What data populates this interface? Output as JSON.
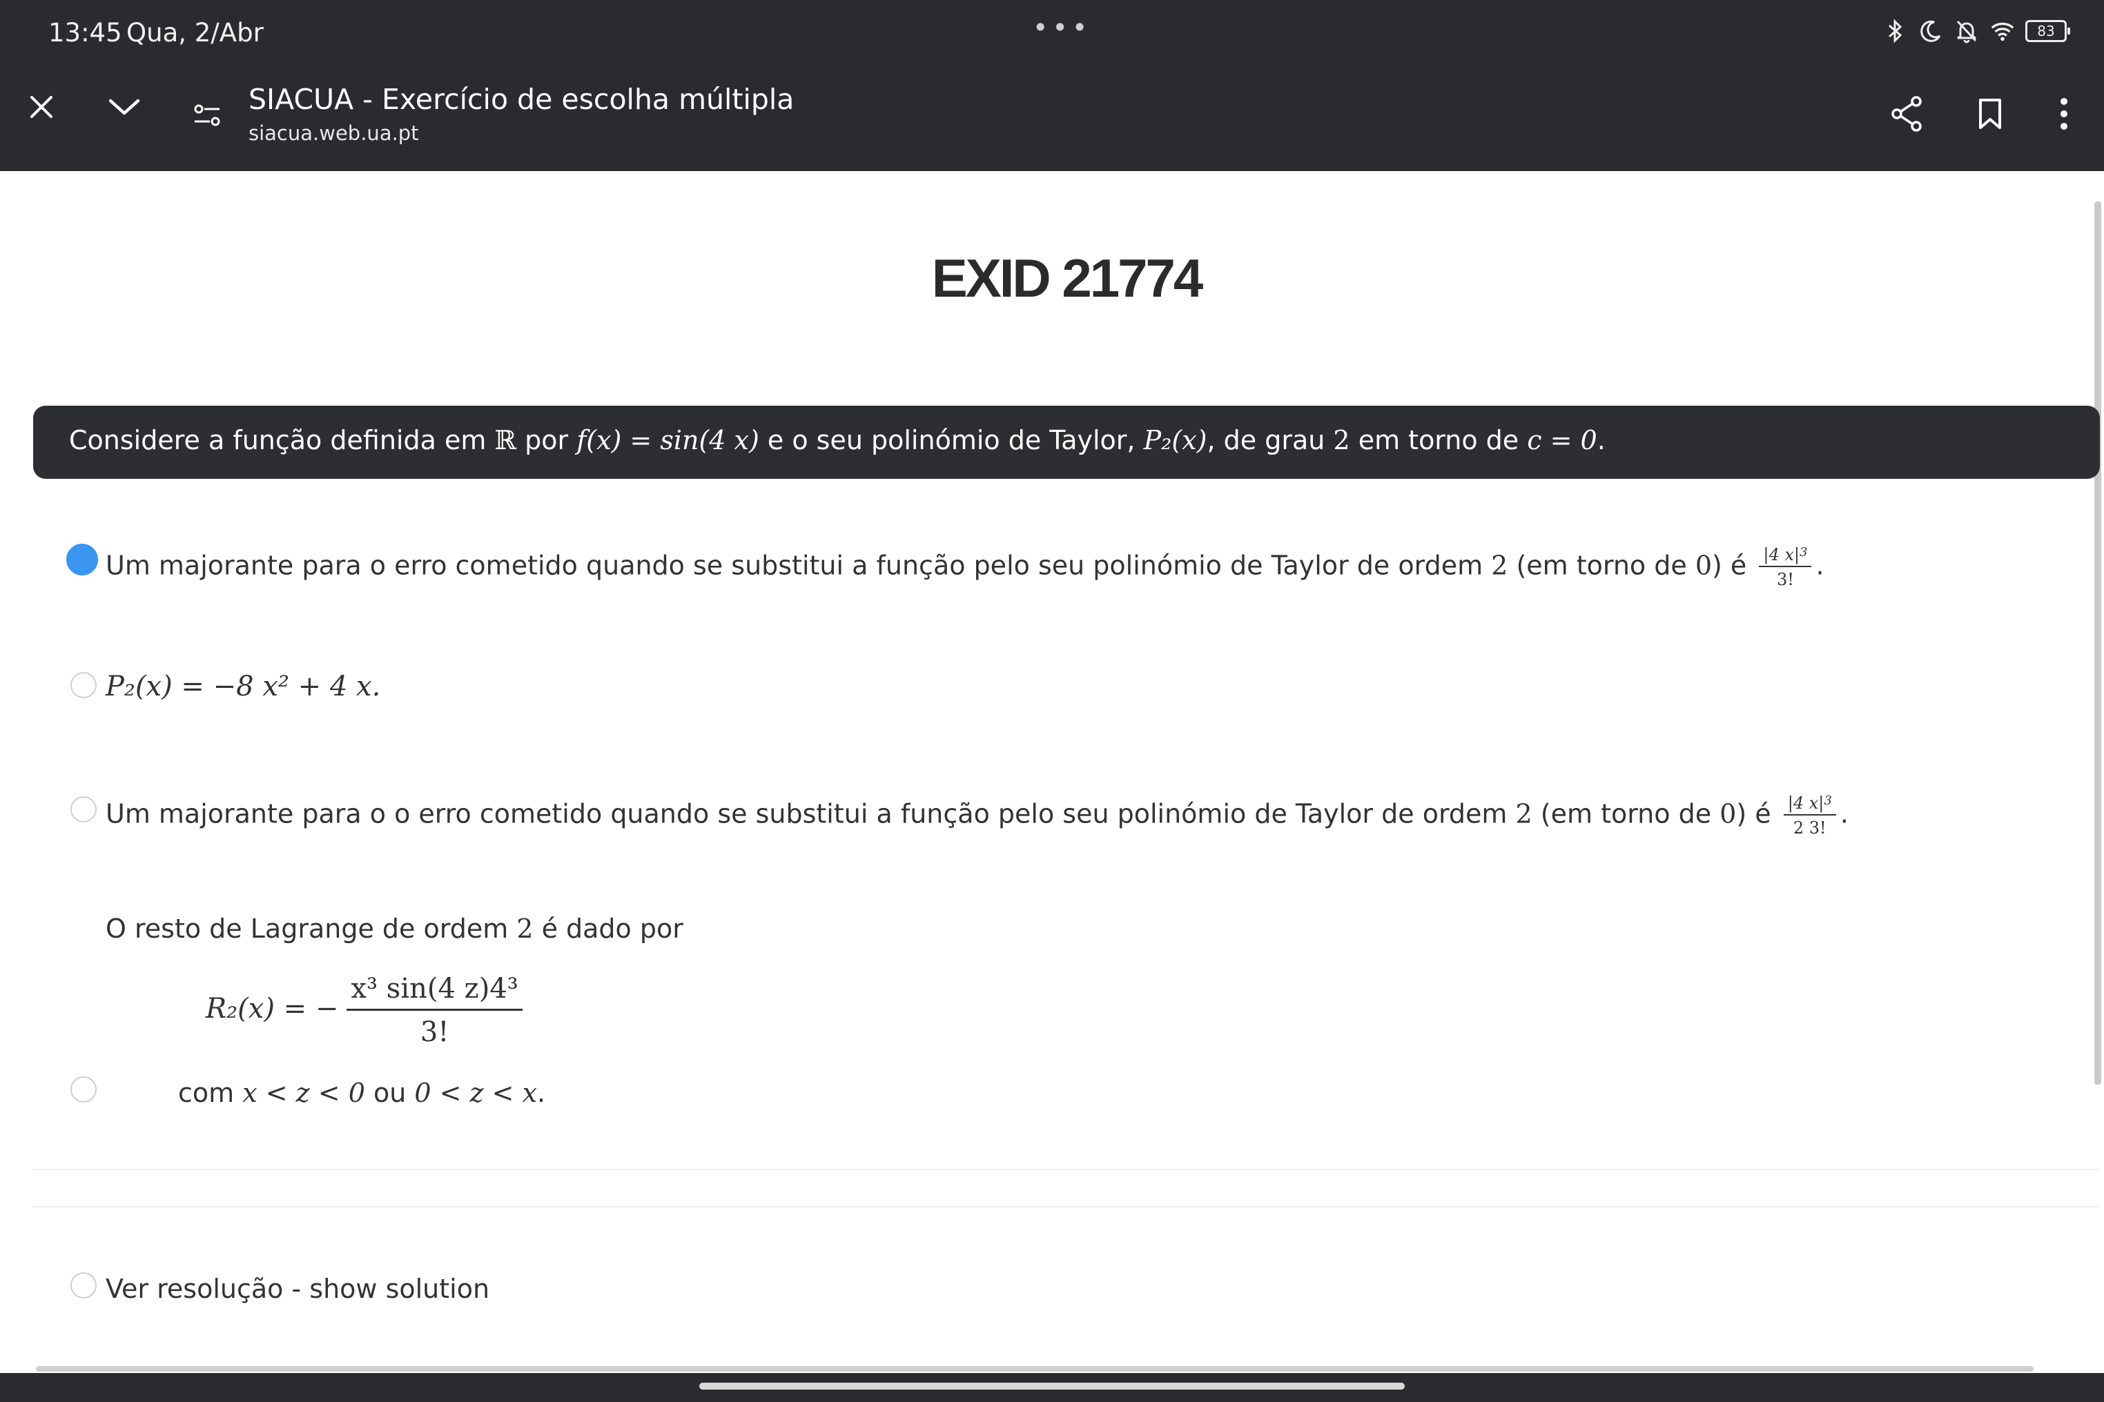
{
  "status": {
    "time": "13:45",
    "date": "Qua, 2/Abr",
    "dots": "•••",
    "battery": "83",
    "icons": [
      "bluetooth-icon",
      "moon-icon",
      "bell-off-icon",
      "wifi-icon",
      "battery-icon"
    ]
  },
  "toolbar": {
    "title": "SIACUA - Exercício de escolha múltipla",
    "url": "siacua.web.ua.pt",
    "icons": [
      "close-icon",
      "chevron-down-icon",
      "page-info-icon",
      "share-icon",
      "bookmark-icon",
      "more-vert-icon"
    ]
  },
  "page": {
    "title": "EXID 21774"
  },
  "question": {
    "t1": "Considere a função definida em ",
    "R": "ℝ",
    "t2": " por ",
    "func": "f(x) = sin(4 x)",
    "t3": " e o seu polinómio de Taylor, ",
    "poly": "P₂(x)",
    "t4": ", de grau ",
    "deg": "2",
    "t5": " em torno de ",
    "center": "c = 0",
    "t6": "."
  },
  "options": {
    "a": {
      "text": "Um majorante para o erro cometido quando se substitui a função pelo seu polinómio de Taylor de ordem ",
      "n": "2",
      "mid": " (em torno de ",
      "zero": "0",
      "end": ") é ",
      "num": "|4 x|",
      "exp": "3",
      "den": "3!",
      "period": ".",
      "selected": true
    },
    "b": {
      "text": "P₂(x) = −8 x² + 4 x."
    },
    "c": {
      "text": "Um majorante para o o erro cometido quando se substitui a função pelo seu polinómio de Taylor de ordem ",
      "n": "2",
      "mid": " (em torno de ",
      "zero": "0",
      "end": ") é ",
      "num": "|4 x|",
      "exp": "3",
      "den": "2 3!",
      "period": "."
    },
    "d": {
      "line1a": "O resto de Lagrange de ordem ",
      "line1n": "2",
      "line1b": " é dado por",
      "lhs": "R₂(x) = −",
      "num": "x³ sin(4 z)4³",
      "den": "3!",
      "line3a": "com ",
      "cond1": "x < z < 0",
      "ou": " ou ",
      "cond2": "0 < z < x",
      "line3b": "."
    },
    "solution": "Ver resolução - show solution"
  },
  "colors": {
    "bar": "#2a2b2e",
    "accent": "#3a95f0",
    "question_bg": "#2d2e31"
  }
}
